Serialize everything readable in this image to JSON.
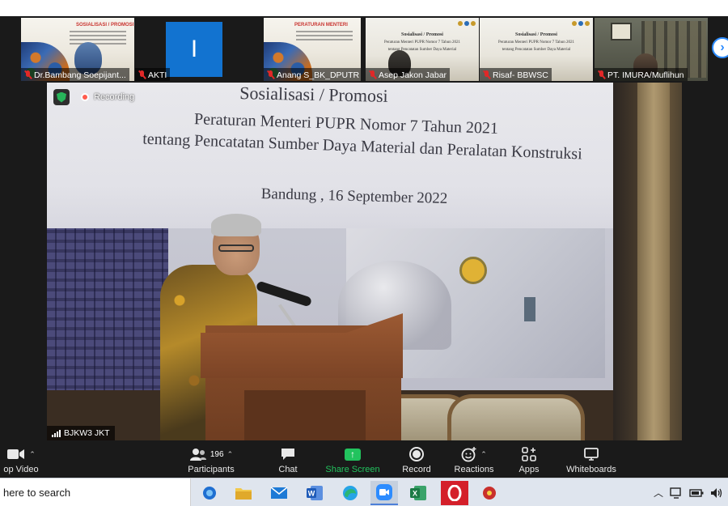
{
  "gallery": {
    "tiles": [
      {
        "name": "Dr.Bambang Soepijant...",
        "muted": true,
        "kind": "slide-batik"
      },
      {
        "name": "AKTI",
        "muted": true,
        "kind": "initial",
        "initial": "I"
      },
      {
        "name": "Anang S_BK_DPUTR K...",
        "muted": true,
        "kind": "slide-batik"
      },
      {
        "name": "Asep Jakon Jabar",
        "muted": true,
        "kind": "promo"
      },
      {
        "name": "Risaf- BBWSC",
        "muted": true,
        "kind": "promo"
      },
      {
        "name": "PT. IMURA/Muflihun",
        "muted": true,
        "kind": "room"
      }
    ]
  },
  "main_video": {
    "recording_label": "Recording",
    "participant_name": "BJKW3 JKT",
    "banner": {
      "line1": "Sosialisasi / Promosi",
      "line2": "Peraturan Menteri PUPR Nomor 7 Tahun 2021",
      "line3": "tentang Pencatatan Sumber Daya Material dan Peralatan Konstruksi",
      "line4": "Bandung , 16 September 2022"
    }
  },
  "toolbar": {
    "video_label": "op Video",
    "participants_label": "Participants",
    "participants_count": "196",
    "chat_label": "Chat",
    "share_label": "Share Screen",
    "record_label": "Record",
    "reactions_label": "Reactions",
    "apps_label": "Apps",
    "whiteboards_label": "Whiteboards"
  },
  "taskbar": {
    "search_text": "here to search",
    "apps": [
      "edge-icon",
      "file-explorer-icon",
      "mail-icon",
      "word-icon",
      "edge-browser-icon",
      "zoom-icon",
      "excel-icon",
      "opera-icon",
      "app-icon"
    ]
  },
  "colors": {
    "zoom_blue": "#1273d0",
    "share_green": "#22c35e",
    "recording_red": "#ff5c4d",
    "muted_red": "#e02828"
  }
}
